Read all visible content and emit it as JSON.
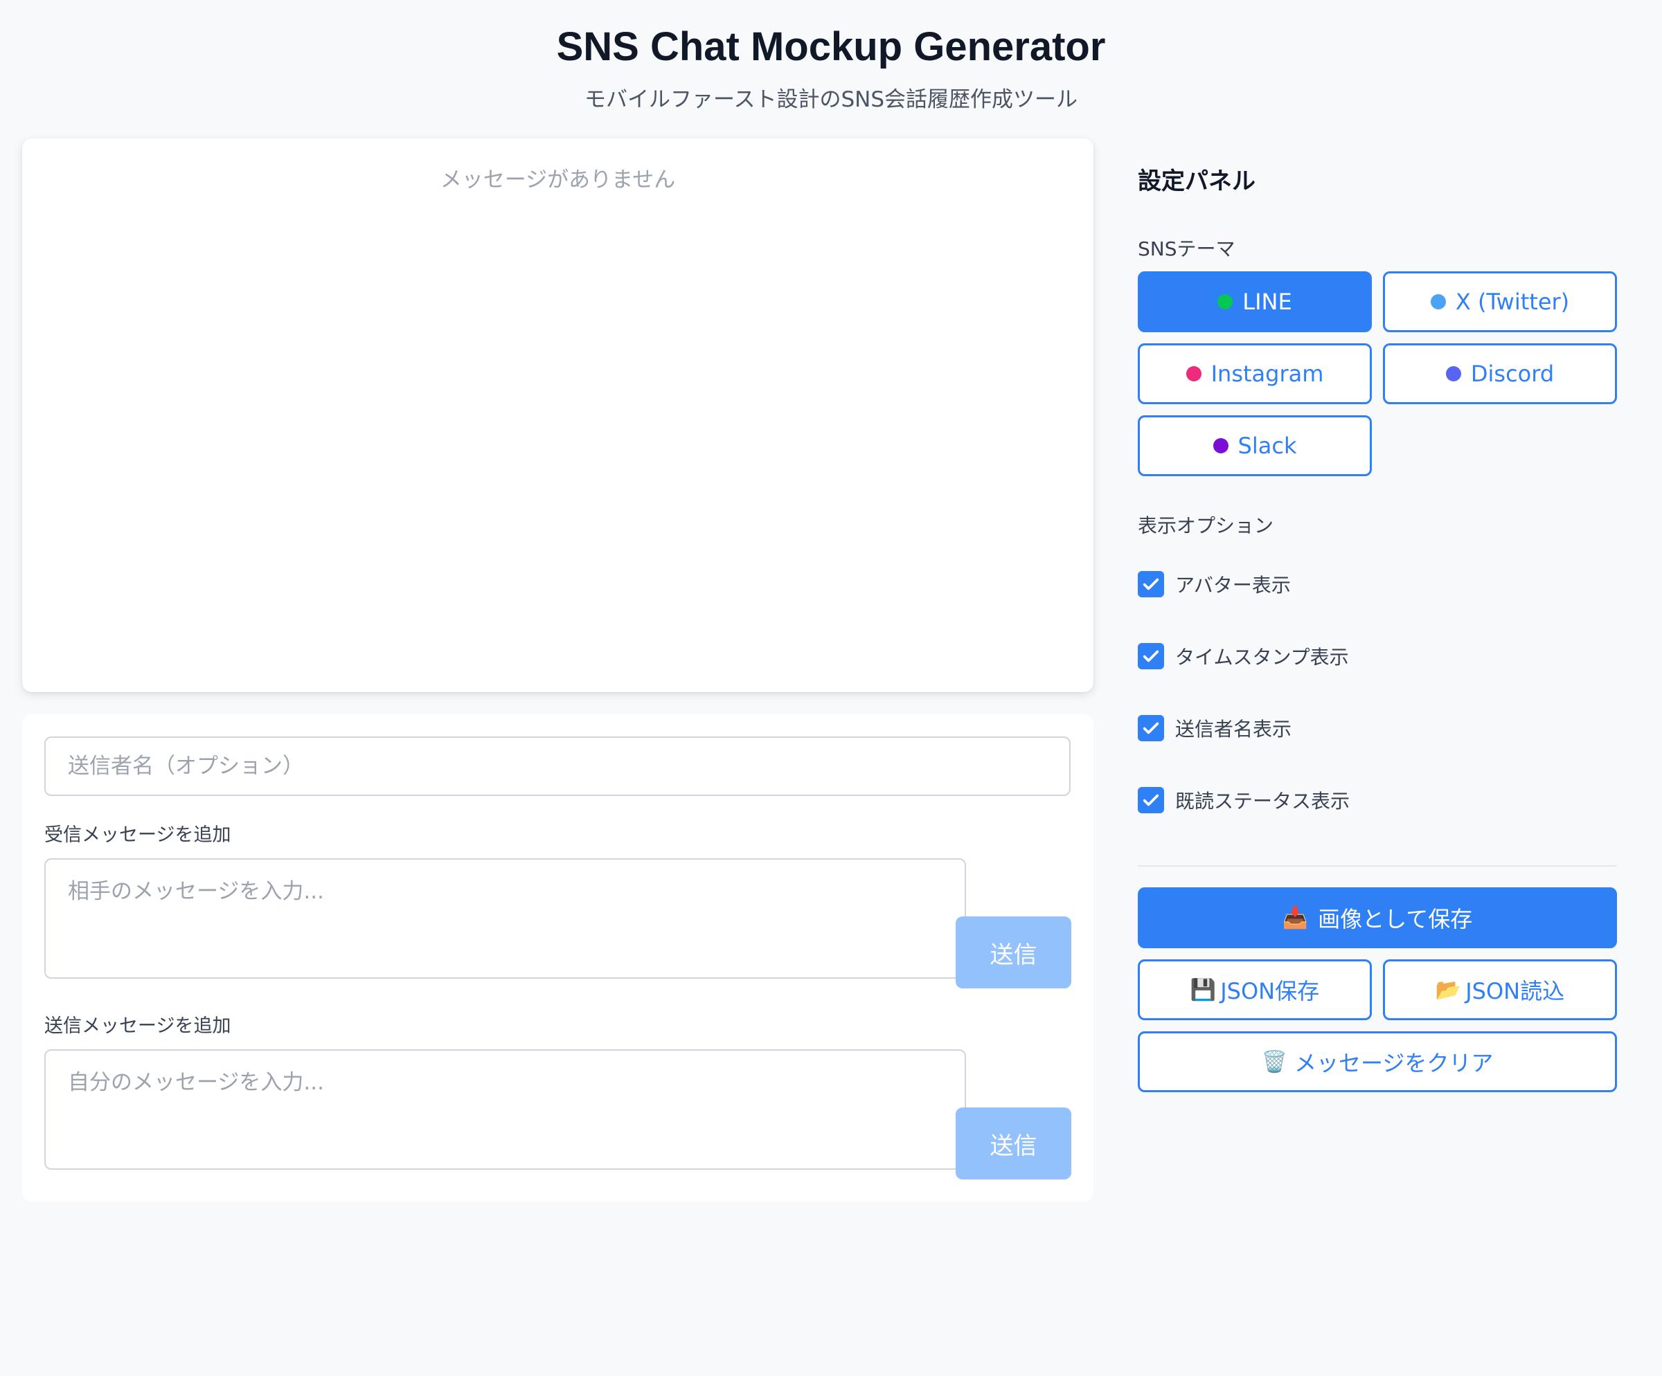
{
  "header": {
    "title": "SNS Chat Mockup Generator",
    "subtitle": "モバイルファースト設計のSNS会話履歴作成ツール"
  },
  "chat": {
    "empty_text": "メッセージがありません"
  },
  "composer": {
    "sender_placeholder": "送信者名（オプション）",
    "received_label": "受信メッセージを追加",
    "received_placeholder": "相手のメッセージを入力...",
    "sent_label": "送信メッセージを追加",
    "sent_placeholder": "自分のメッセージを入力...",
    "send_label": "送信"
  },
  "settings": {
    "title": "設定パネル",
    "theme_label": "SNSテーマ",
    "themes": [
      {
        "label": "LINE",
        "color": "#06c755",
        "active": true
      },
      {
        "label": "X (Twitter)",
        "color": "#4aa3f5",
        "active": false
      },
      {
        "label": "Instagram",
        "color": "#ee2a7b",
        "active": false
      },
      {
        "label": "Discord",
        "color": "#5865f2",
        "active": false
      },
      {
        "label": "Slack",
        "color": "#7b0fd8",
        "active": false
      }
    ],
    "display_label": "表示オプション",
    "options": [
      {
        "label": "アバター表示",
        "checked": true
      },
      {
        "label": "タイムスタンプ表示",
        "checked": true
      },
      {
        "label": "送信者名表示",
        "checked": true
      },
      {
        "label": "既読ステータス表示",
        "checked": true
      }
    ],
    "actions": {
      "save_image_icon": "📥",
      "save_image": "画像として保存",
      "json_save_icon": "💾",
      "json_save": "JSON保存",
      "json_load_icon": "📂",
      "json_load": "JSON読込",
      "clear_icon": "🗑️",
      "clear": "メッセージをクリア"
    }
  },
  "colors": {
    "accent": "#2f7ff5",
    "send_button": "#93c1fb"
  }
}
